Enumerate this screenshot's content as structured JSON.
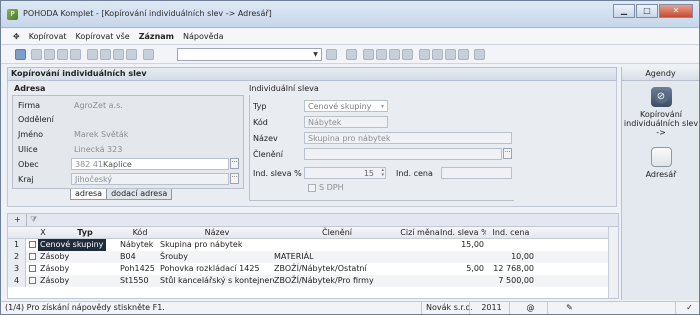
{
  "window": {
    "title": "POHODA Komplet - [Kopírování individuálních slev -> Adresář]",
    "buttons": {
      "minimize": "▁",
      "maximize": "□",
      "close": "✕"
    }
  },
  "menu": {
    "items": [
      "Kopírovat",
      "Kopírovat vše",
      "Záznam",
      "Nápověda"
    ]
  },
  "dialog": {
    "caption": "Kopírování individuálních slev"
  },
  "adresa": {
    "title": "Adresa",
    "labels": {
      "firma": "Firma",
      "oddeleni": "Oddělení",
      "jmeno": "Jméno",
      "ulice": "Ulice",
      "obec": "Obec",
      "kraj": "Kraj"
    },
    "firma": "AgroZet a.s.",
    "oddeleni": "",
    "jmeno": "Marek Světák",
    "ulice": "Linecká 323",
    "psc": "382 41",
    "obec": "Kaplice",
    "kraj": "Jihočeský",
    "tabs": [
      "adresa",
      "dodací adresa"
    ]
  },
  "sleva": {
    "title": "Individuální sleva",
    "labels": {
      "typ": "Typ",
      "kod": "Kód",
      "nazev": "Název",
      "cleneni": "Členění",
      "ind_sleva": "Ind. sleva %",
      "ind_cena": "Ind. cena",
      "s_dph": "S DPH"
    },
    "typ": "Cenové skupiny",
    "kod": "Nábytek",
    "nazev": "Skupina pro nábytek",
    "cleneni": "",
    "ind_sleva": "15",
    "ind_cena": "",
    "s_dph_checked": false
  },
  "agendy": {
    "title": "Agendy",
    "items": [
      {
        "label_1": "Kopírování",
        "label_2": "individuálních slev",
        "label_3": "->",
        "icon": "copy-icon"
      },
      {
        "label_1": "Adresář",
        "icon": "address-book-icon"
      }
    ]
  },
  "grid": {
    "columns": [
      "X",
      "Typ",
      "Kód",
      "Název",
      "Členění",
      "Cizí měna",
      "Ind. sleva %",
      "Ind. cena"
    ],
    "rows": [
      {
        "n": "1",
        "typ": "Cenové skupiny",
        "kod": "Nábytek",
        "nazev": "Skupina pro nábytek",
        "cleneni": "",
        "mena": "",
        "sleva": "15,00",
        "cena": ""
      },
      {
        "n": "2",
        "typ": "Zásoby",
        "kod": "B04",
        "nazev": "Šrouby",
        "cleneni": "MATERIÁL",
        "mena": "",
        "sleva": "",
        "cena": "10,00"
      },
      {
        "n": "3",
        "typ": "Zásoby",
        "kod": "Poh1425",
        "nazev": "Pohovka rozkládací 1425",
        "cleneni": "ZBOŽÍ/Nábytek/Ostatní",
        "mena": "",
        "sleva": "5,00",
        "cena": "12 768,00"
      },
      {
        "n": "4",
        "typ": "Zásoby",
        "kod": "St1550",
        "nazev": "Stůl kancelářský s kontejnerem",
        "cleneni": "ZBOŽÍ/Nábytek/Pro firmy",
        "mena": "",
        "sleva": "",
        "cena": "7 500,00"
      }
    ]
  },
  "status": {
    "hint": "(1/4) Pro získání nápovědy stiskněte F1.",
    "company": "Novák s.r.o.",
    "year": "2011",
    "at": "@"
  }
}
